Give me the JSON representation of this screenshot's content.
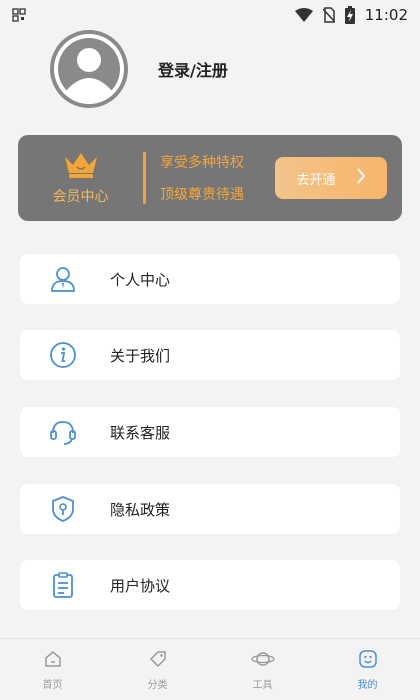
{
  "status_bar": {
    "time": "11:02",
    "icons": [
      "qr-icon",
      "wifi-icon",
      "no-sim-icon",
      "battery-charging-icon"
    ]
  },
  "profile": {
    "login_label": "登录/注册",
    "avatar_icon": "default-avatar-icon"
  },
  "vip": {
    "title": "会员中心",
    "icon": "crown-icon",
    "line1": "享受多种特权",
    "line2": "顶级尊贵待遇",
    "button_label": "去开通",
    "button_icon": "chevron-right-icon",
    "accent_color": "#f5a536"
  },
  "menu": {
    "items": [
      {
        "label": "个人中心",
        "icon": "user-icon"
      },
      {
        "label": "关于我们",
        "icon": "info-icon"
      },
      {
        "label": "联系客服",
        "icon": "headset-icon"
      },
      {
        "label": "隐私政策",
        "icon": "shield-icon"
      },
      {
        "label": "用户协议",
        "icon": "clipboard-icon"
      }
    ]
  },
  "bottom_nav": {
    "items": [
      {
        "label": "首页",
        "icon": "home-icon"
      },
      {
        "label": "分类",
        "icon": "tag-icon"
      },
      {
        "label": "工具",
        "icon": "planet-icon"
      },
      {
        "label": "我的",
        "icon": "face-icon"
      }
    ],
    "active": "我的",
    "active_color": "#4a8fd8"
  }
}
